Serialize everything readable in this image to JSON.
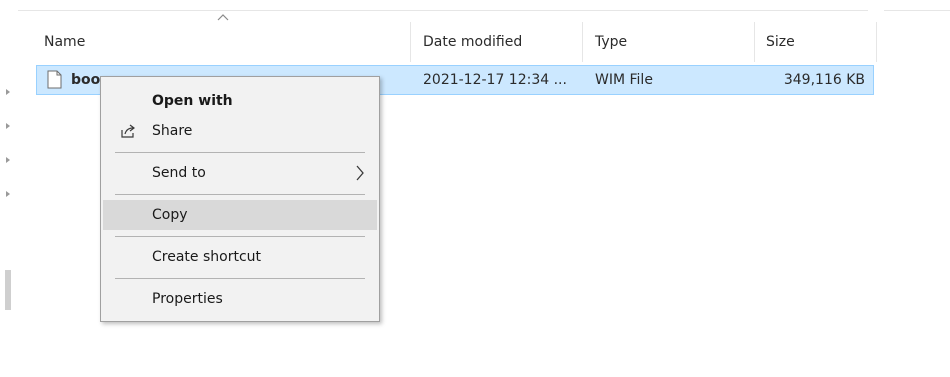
{
  "columns": {
    "name": "Name",
    "date_modified": "Date modified",
    "type": "Type",
    "size": "Size"
  },
  "sort": {
    "column": "Name",
    "icon": "sort-up-chevron"
  },
  "file": {
    "name": "boot.wim",
    "name_visible": "boo",
    "date_modified": "2021-12-17 12:34 ...",
    "type": "WIM File",
    "size": "349,116 KB",
    "icon": "file-icon",
    "selected": true
  },
  "context_menu": {
    "items": [
      {
        "label": "Open with",
        "bold": true
      },
      {
        "label": "Share",
        "icon": "share-icon"
      },
      {
        "label": "Send to",
        "submenu": true
      },
      {
        "label": "Copy",
        "highlighted": true
      },
      {
        "label": "Create shortcut"
      },
      {
        "label": "Properties"
      }
    ]
  },
  "colors": {
    "selection_bg": "#cce8ff",
    "selection_border": "#99d1ff",
    "menu_bg": "#f2f2f2",
    "menu_hover": "#d9d9d9"
  }
}
